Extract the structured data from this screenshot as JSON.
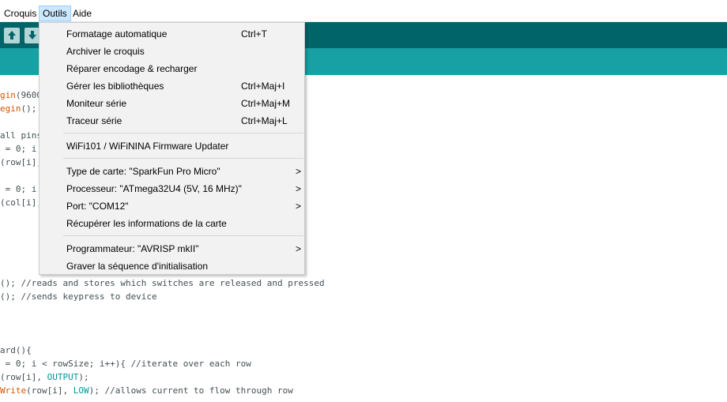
{
  "menubar": {
    "items": [
      "Croquis",
      "Outils",
      "Aide"
    ]
  },
  "toolbar": {
    "buttons": [
      {
        "icon": "upload-arrow-icon"
      },
      {
        "icon": "download-arrow-icon"
      }
    ]
  },
  "dropdown": {
    "items": [
      {
        "label": "Formatage automatique",
        "shortcut": "Ctrl+T"
      },
      {
        "label": "Archiver le croquis",
        "shortcut": ""
      },
      {
        "label": "Réparer encodage & recharger",
        "shortcut": ""
      },
      {
        "label": "Gérer les bibliothèques",
        "shortcut": "Ctrl+Maj+I"
      },
      {
        "label": "Moniteur série",
        "shortcut": "Ctrl+Maj+M"
      },
      {
        "label": "Traceur série",
        "shortcut": "Ctrl+Maj+L"
      },
      {
        "label": "WiFi101 / WiFiNINA Firmware Updater",
        "shortcut": ""
      },
      {
        "label": "Type de carte: \"SparkFun Pro Micro\"",
        "submenu": ">"
      },
      {
        "label": "Processeur: \"ATmega32U4 (5V, 16 MHz)\"",
        "submenu": ">"
      },
      {
        "label": "Port: \"COM12\"",
        "submenu": ">"
      },
      {
        "label": "Récupérer les informations de la carte",
        "submenu": ""
      },
      {
        "label": "Programmateur: \"AVRISP mkII\"",
        "submenu": ">"
      },
      {
        "label": "Graver la séquence d'initialisation",
        "submenu": ""
      }
    ]
  },
  "code": {
    "l1a": "gin",
    "l1b": "(9600",
    "l2a": "egin",
    "l2b": "();",
    "l3": "all pins",
    "l4": " = 0; i",
    "l5": "(row[i],",
    "l6": " = 0; i",
    "l7": "(col[i],",
    "l8": "(); //reads and stores which switches are released and pressed",
    "l9": "(); //sends keypress to device",
    "l10": "ard(){",
    "l11": " = 0; i < rowSize; i++){ //iterate over each row",
    "l12a": "(row[i], ",
    "l12b": "OUTPUT",
    "l12c": ");",
    "l13a": "Write",
    "l13b": "(row[i], ",
    "l13c": "LOW",
    "l13d": "); //allows current to flow through row"
  }
}
